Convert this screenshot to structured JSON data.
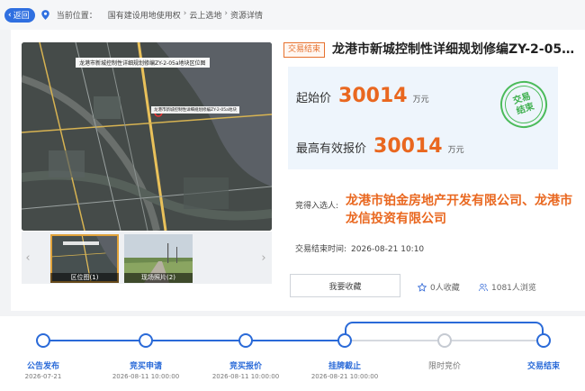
{
  "topbar": {
    "back_label": "返回",
    "location_prefix": "当前位置：",
    "breadcrumbs": [
      "国有建设用地使用权",
      "云上选地",
      "资源详情"
    ]
  },
  "gallery": {
    "map_title": "龙港市新城控制性详细规划修编ZY-2-05a地块区位图",
    "map_label": "龙港市新城控制性详细规划修编ZY-2-05a地块",
    "thumbs": [
      {
        "caption": "区位图(1)"
      },
      {
        "caption": "现场照片(2)"
      }
    ]
  },
  "detail": {
    "status_tag": "交易结束",
    "title": "龙港市新城控制性详细规划修编ZY-2-05a...",
    "start_price_label": "起始价",
    "start_price_value": "30014",
    "start_price_unit": "万元",
    "max_bid_label": "最高有效报价",
    "max_bid_value": "30014",
    "max_bid_unit": "万元",
    "stamp_line1": "交易",
    "stamp_line2": "结束",
    "winner_label": "竞得入选人:",
    "winner_name": "龙港市铂金房地产开发有限公司、龙港市龙信投资有限公司",
    "end_time_label": "交易结束时间:",
    "end_time_value": "2026-08-21 10:10",
    "favorite_button": "我要收藏",
    "collect_count": "0人收藏",
    "view_count": "1081人浏览"
  },
  "timeline": {
    "steps": [
      {
        "label": "公告发布",
        "date": "2026-07-21",
        "active": true
      },
      {
        "label": "竞买申请",
        "date": "2026-08-11 10:00:00",
        "active": true
      },
      {
        "label": "竞买报价",
        "date": "2026-08-11 10:00:00",
        "active": true
      },
      {
        "label": "挂牌截止",
        "date": "2026-08-21 10:00:00",
        "active": true
      },
      {
        "label": "限时竞价",
        "date": "",
        "active": false
      },
      {
        "label": "交易结束",
        "date": "",
        "active": true
      }
    ]
  },
  "colors": {
    "accent_blue": "#2a6ad8",
    "price_orange": "#e9671f",
    "stamp_green": "#4bbb5a"
  }
}
